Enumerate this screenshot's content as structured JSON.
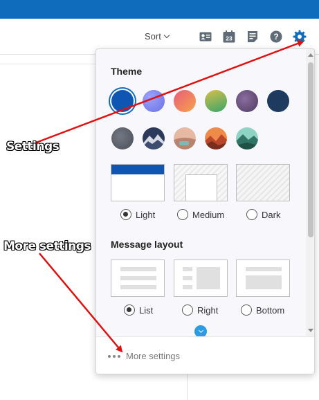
{
  "toolbar": {
    "sort_label": "Sort",
    "icons": [
      "contact-card-icon",
      "calendar-icon",
      "notes-icon",
      "help-icon",
      "settings-icon"
    ],
    "calendar_day": "23",
    "help_glyph": "?"
  },
  "settings_panel": {
    "theme_title": "Theme",
    "theme_swatches": [
      {
        "name": "blue",
        "color": "#0f56b3",
        "selected": true
      },
      {
        "name": "purple",
        "color": "#7b83eb"
      },
      {
        "name": "sunset",
        "color": "#f0845a"
      },
      {
        "name": "green-yellow",
        "color": "#6fba6a"
      },
      {
        "name": "plum",
        "color": "#6b4a7d"
      },
      {
        "name": "navy",
        "color": "#1e3a5f"
      },
      {
        "name": "slate",
        "color": "#5b5f6a"
      },
      {
        "name": "mountain-night",
        "color": "#2b3a5a"
      },
      {
        "name": "desert",
        "color": "#c89a84"
      },
      {
        "name": "autumn",
        "color": "#d7643a"
      },
      {
        "name": "forest",
        "color": "#4f9a8a"
      }
    ],
    "modes": [
      {
        "label": "Light",
        "selected": true
      },
      {
        "label": "Medium",
        "selected": false
      },
      {
        "label": "Dark",
        "selected": false
      }
    ],
    "layout_title": "Message layout",
    "layouts": [
      {
        "label": "List",
        "selected": true
      },
      {
        "label": "Right",
        "selected": false
      },
      {
        "label": "Bottom",
        "selected": false
      }
    ],
    "more_settings_label": "More settings"
  },
  "annotations": {
    "settings_label": "Settings",
    "more_settings_label": "More settings"
  },
  "colors": {
    "brand_blue": "#0f6cbd",
    "arrow_red": "#e01010",
    "expand_button": "#2b9be3"
  }
}
